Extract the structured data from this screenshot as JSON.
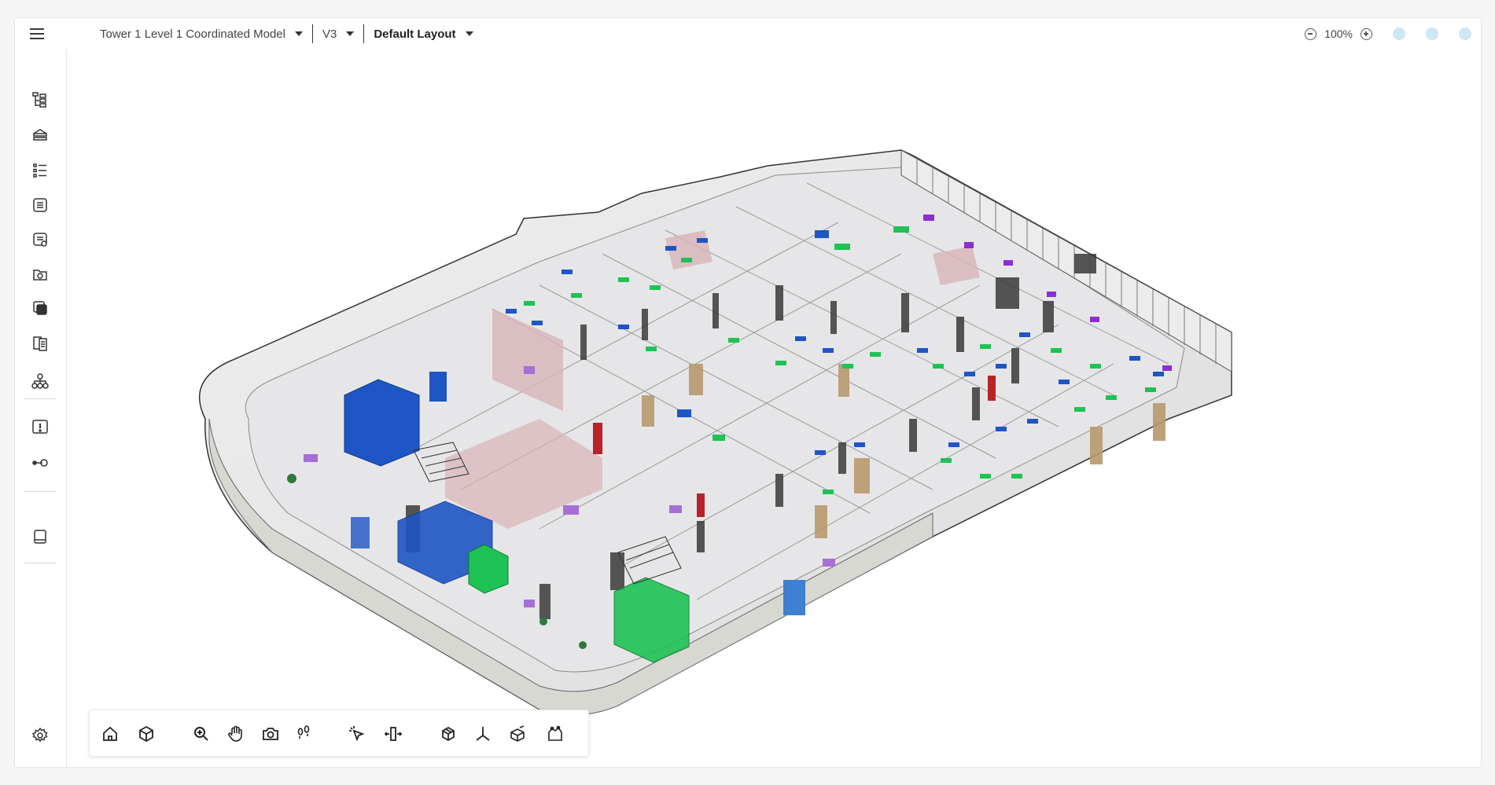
{
  "header": {
    "model_name": "Tower 1 Level 1 Coordinated Model",
    "version": "V3",
    "layout": "Default Layout",
    "zoom_level": "100%"
  },
  "sidebar": {
    "items": [
      {
        "icon": "model-tree-icon"
      },
      {
        "icon": "layers-icon"
      },
      {
        "icon": "list-icon"
      },
      {
        "icon": "properties-icon"
      },
      {
        "icon": "reports-icon"
      },
      {
        "icon": "views-icon"
      },
      {
        "icon": "sections-icon"
      },
      {
        "icon": "documents-icon"
      },
      {
        "icon": "hierarchy-icon"
      },
      {
        "icon": "issues-icon"
      },
      {
        "icon": "connections-icon"
      },
      {
        "icon": "book-icon"
      },
      {
        "icon": "settings-icon"
      }
    ]
  },
  "toolbar": {
    "tools": [
      {
        "icon": "home-icon"
      },
      {
        "icon": "cube-icon"
      },
      {
        "icon": "zoom-icon"
      },
      {
        "icon": "pan-hand-icon"
      },
      {
        "icon": "camera-icon"
      },
      {
        "icon": "walk-icon"
      },
      {
        "icon": "select-icon"
      },
      {
        "icon": "move-icon"
      },
      {
        "icon": "box-view-icon"
      },
      {
        "icon": "axis-icon"
      },
      {
        "icon": "section-box-icon"
      },
      {
        "icon": "measure-icon"
      }
    ]
  },
  "colors": {
    "accent_dot": "#cfe7f3",
    "mep_blue": "#1f55c4",
    "mep_green": "#1fc255",
    "mep_purple": "#8c2fd0",
    "wall_pink": "#d8b4b8",
    "door_tan": "#b8996e"
  }
}
